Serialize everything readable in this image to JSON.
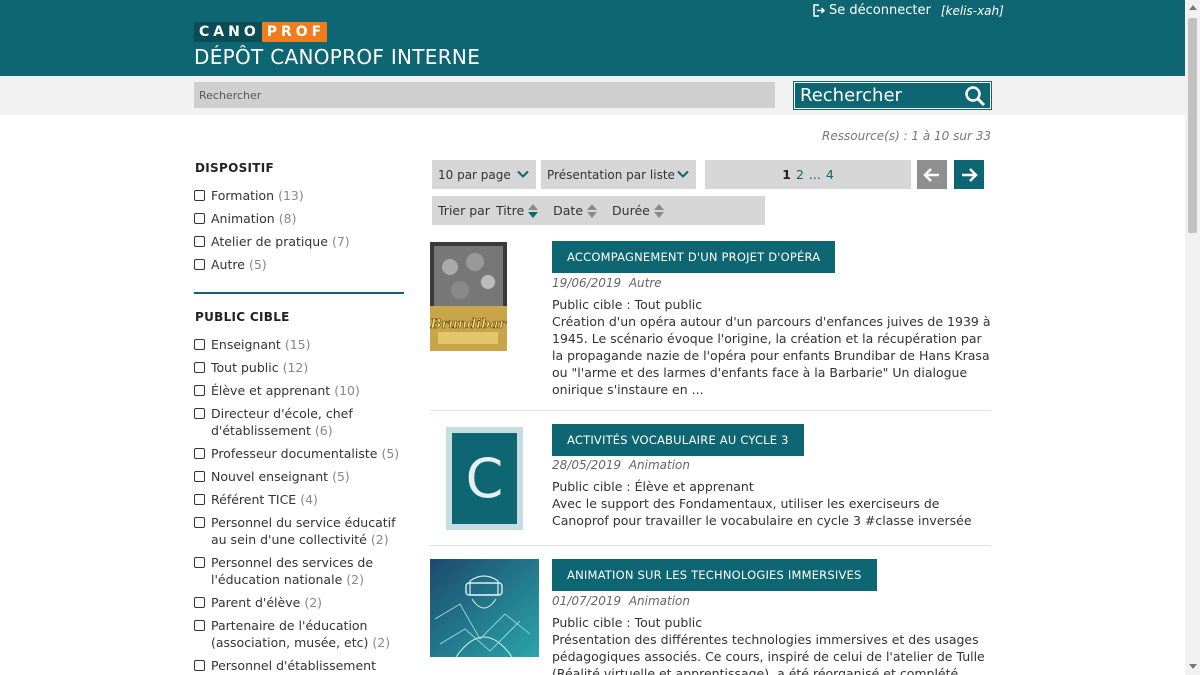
{
  "header": {
    "logo_part1": "CANO",
    "logo_part2": "PROF",
    "site_title": "DÉPÔT CANOPROF INTERNE",
    "logout_label": "Se déconnecter",
    "username": "[kelis-xah]"
  },
  "search": {
    "placeholder": "Rechercher",
    "button_label": "Rechercher"
  },
  "results_summary": "Ressource(s) : 1 à 10 sur 33",
  "facets": {
    "dispositif": {
      "title": "DISPOSITIF",
      "items": [
        {
          "label": "Formation",
          "count": "(13)"
        },
        {
          "label": "Animation",
          "count": "(8)"
        },
        {
          "label": "Atelier de pratique",
          "count": "(7)"
        },
        {
          "label": "Autre",
          "count": "(5)"
        }
      ]
    },
    "public": {
      "title": "PUBLIC CIBLE",
      "items": [
        {
          "label": "Enseignant",
          "count": "(15)"
        },
        {
          "label": "Tout public",
          "count": "(12)"
        },
        {
          "label": "Élève et apprenant",
          "count": "(10)"
        },
        {
          "label": "Directeur d'école, chef d'établissement",
          "count": "(6)"
        },
        {
          "label": "Professeur documentaliste",
          "count": "(5)"
        },
        {
          "label": "Nouvel enseignant",
          "count": "(5)"
        },
        {
          "label": "Référent TICE",
          "count": "(4)"
        },
        {
          "label": "Personnel du service éducatif au sein d'une collectivité",
          "count": "(2)"
        },
        {
          "label": "Personnel des services de l'éducation nationale",
          "count": "(2)"
        },
        {
          "label": "Parent d'élève",
          "count": "(2)"
        },
        {
          "label": "Partenaire de l'éducation (association, musée, etc)",
          "count": "(2)"
        },
        {
          "label": "Personnel d'établissement",
          "count": ""
        }
      ]
    }
  },
  "controls": {
    "per_page": "10 par page",
    "view_mode": "Présentation par liste",
    "pages": [
      "1",
      "2",
      "...",
      "4"
    ],
    "sort_label": "Trier par",
    "sort_keys": [
      "Titre",
      "Date",
      "Durée"
    ]
  },
  "results": [
    {
      "title": "ACCOMPAGNEMENT D'UN PROJET D'OPÉRA",
      "date": "19/06/2019",
      "type": "Autre",
      "public": "Public cible : Tout public",
      "description": "Création d'un opéra autour d'un parcours d'enfances juives de 1939 à 1945. Le scénario évoque l'origine, la création et la récupération par la propagande nazie de l'opéra pour enfants Brundibar de Hans Krasa ou \"l'arme et des larmes d'enfants face à la Barbarie\" Un dialogue onirique s'instaure en ...",
      "thumb_text": "Brundibar"
    },
    {
      "title": "ACTIVITÉS VOCABULAIRE AU CYCLE 3",
      "date": "28/05/2019",
      "type": "Animation",
      "public": "Public cible : Élève et apprenant",
      "description": "Avec le support des Fondamentaux, utiliser les exerciseurs de Canoprof pour travailler le vocabulaire en cycle 3 #classe inversée",
      "thumb_text": "C"
    },
    {
      "title": "ANIMATION SUR LES TECHNOLOGIES IMMERSIVES",
      "date": "01/07/2019",
      "type": "Animation",
      "public": "Public cible : Tout public",
      "description": "Présentation des différentes technologies immersives et des usages pédagogiques associés. Ce cours, inspiré de celui de l'atelier de Tulle (Réalité virtuelle et apprentissage), a été réorganisé et complété (Réalité",
      "thumb_text": ""
    }
  ],
  "colors": {
    "primary": "#0e6672",
    "accent": "#f07c1b"
  }
}
